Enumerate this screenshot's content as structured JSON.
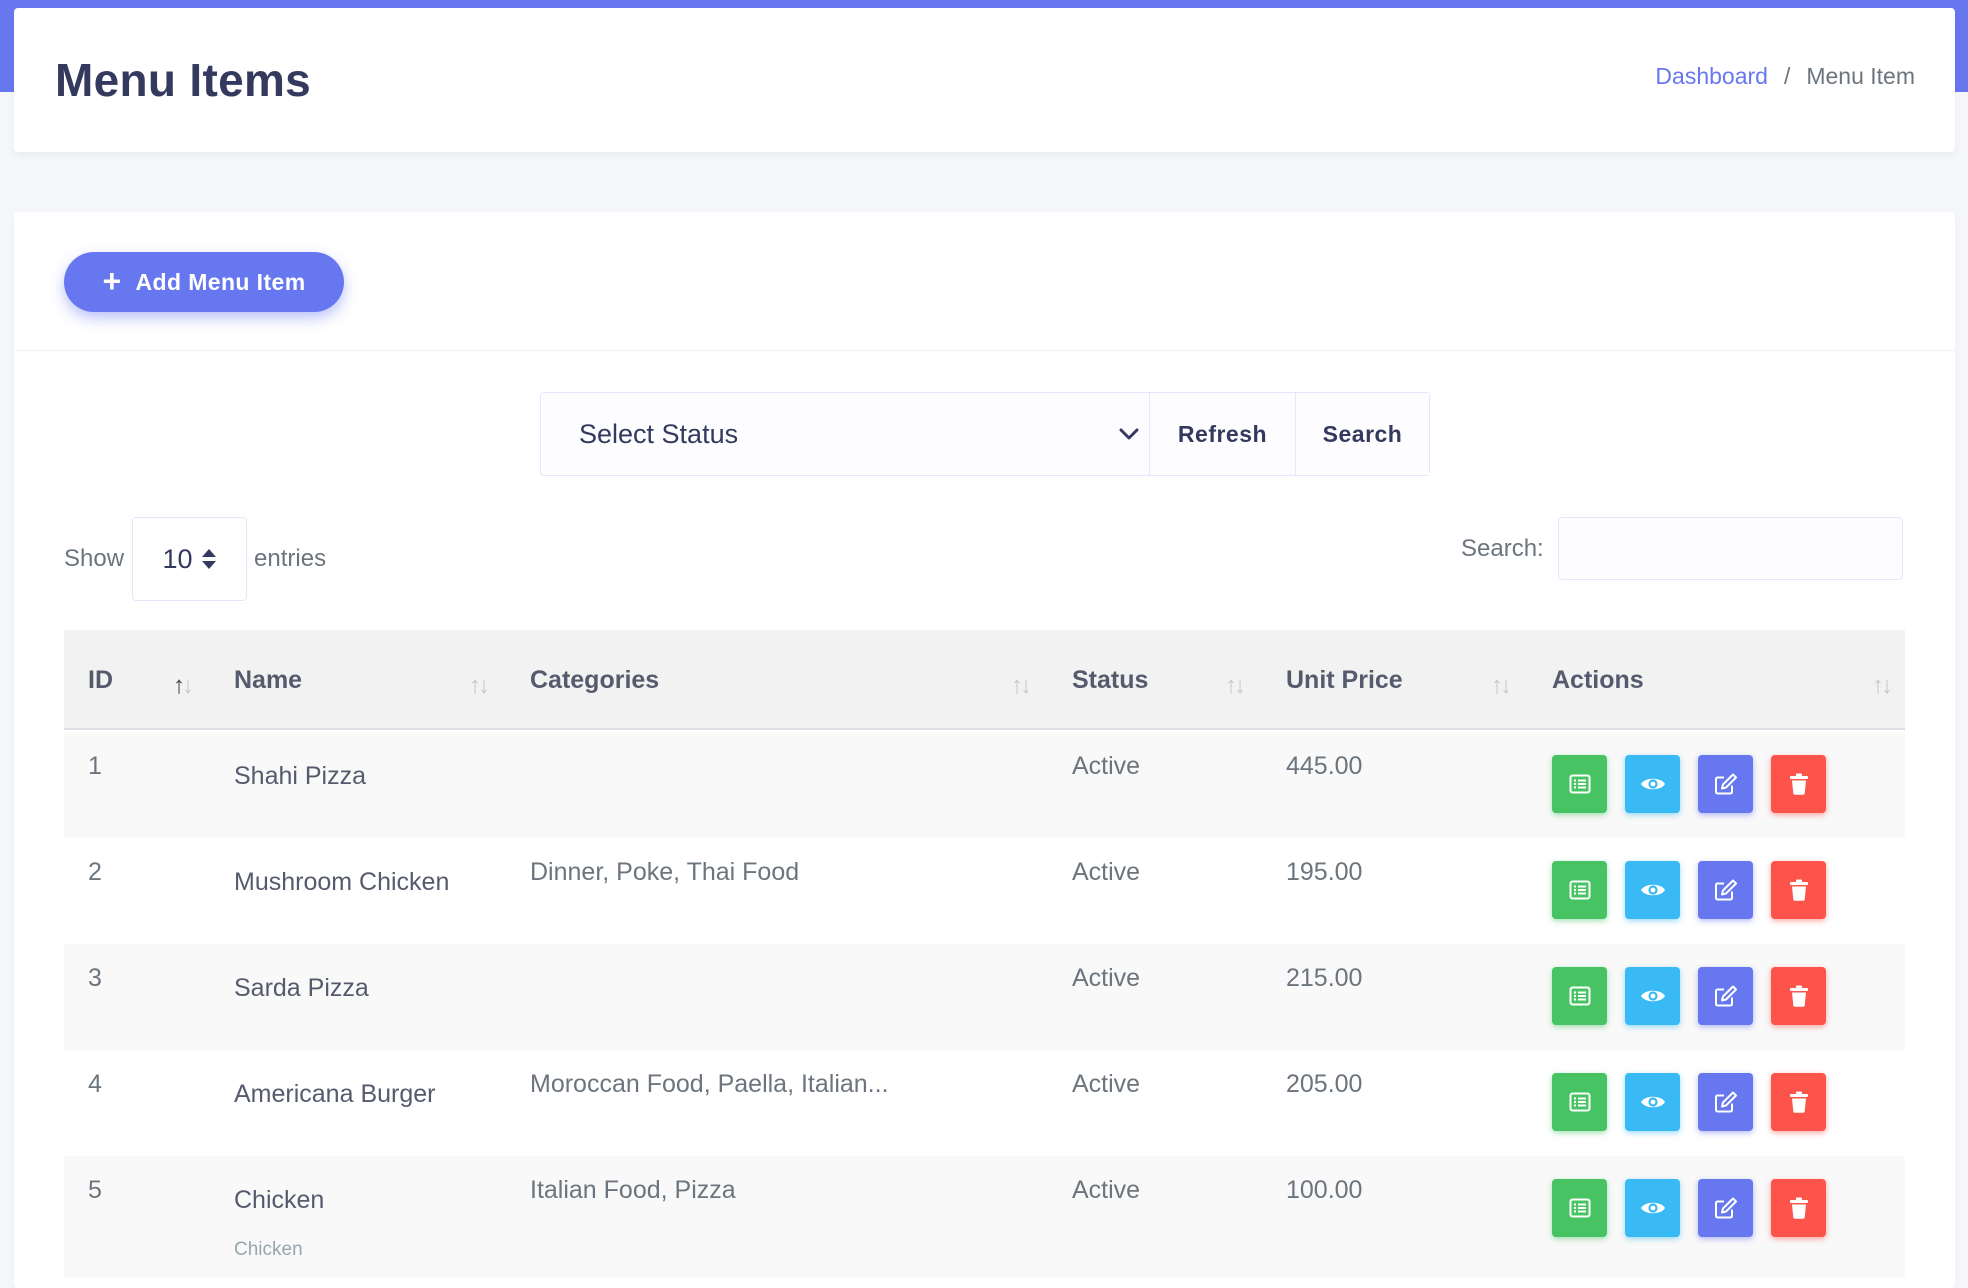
{
  "header": {
    "title": "Menu Items",
    "breadcrumb": {
      "link": "Dashboard",
      "separator": "/",
      "current": "Menu Item"
    }
  },
  "toolbar": {
    "add_label": "Add Menu Item"
  },
  "filter": {
    "status_placeholder": "Select Status",
    "refresh_label": "Refresh",
    "search_label": "Search"
  },
  "length": {
    "show_label": "Show",
    "value": "10",
    "entries_label": "entries"
  },
  "search": {
    "label": "Search:",
    "value": ""
  },
  "table": {
    "columns": [
      "ID",
      "Name",
      "Categories",
      "Status",
      "Unit Price",
      "Actions"
    ],
    "rows": [
      {
        "id": "1",
        "name": "Shahi Pizza",
        "sub": "",
        "categories": "",
        "status": "Active",
        "price": "445.00"
      },
      {
        "id": "2",
        "name": "Mushroom Chicken",
        "sub": "",
        "categories": "Dinner, Poke, Thai Food",
        "status": "Active",
        "price": "195.00"
      },
      {
        "id": "3",
        "name": "Sarda Pizza",
        "sub": "",
        "categories": "",
        "status": "Active",
        "price": "215.00"
      },
      {
        "id": "4",
        "name": "Americana Burger",
        "sub": "",
        "categories": "Moroccan Food, Paella, Italian...",
        "status": "Active",
        "price": "205.00"
      },
      {
        "id": "5",
        "name": "Chicken",
        "sub": "Chicken",
        "categories": "Italian Food, Pizza",
        "status": "Active",
        "price": "100.00"
      }
    ]
  },
  "icons": {
    "add": "plus-icon",
    "select": "chevron-down-icon",
    "length": "sort-updown-icon",
    "actions": [
      "list-icon",
      "eye-icon",
      "edit-icon",
      "trash-icon"
    ]
  },
  "colors": {
    "primary": "#6777ef",
    "success": "#47c363",
    "info": "#3abaf4",
    "danger": "#fc544b",
    "title": "#34395e"
  }
}
